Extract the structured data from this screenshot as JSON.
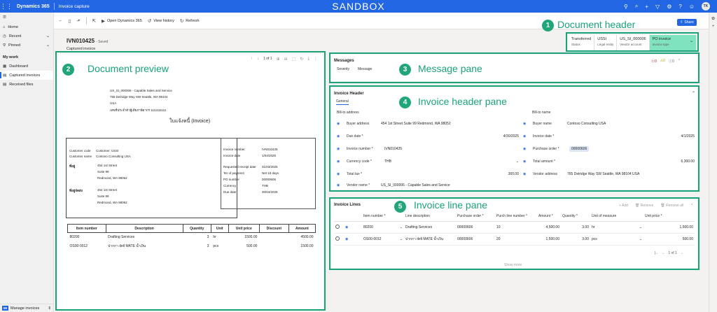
{
  "topbar": {
    "brand": "Dynamics 365",
    "app_name": "Invoice capture",
    "environment": "SANDBOX",
    "user_initials": "TK"
  },
  "nav": {
    "home": "Home",
    "recent": "Recent",
    "pinned": "Pinned",
    "my_work": "My work",
    "dashboard": "Dashboard",
    "captured_invoices": "Captured invoices",
    "received_files": "Received files",
    "bottom_badge": "MI",
    "bottom_label": "Manage invoices"
  },
  "cmdbar": {
    "open_d365": "Open Dynamics 365",
    "view_history": "View history",
    "refresh": "Refresh"
  },
  "share": "Share",
  "document": {
    "id": "IVN010425",
    "saved": "- Saved",
    "subtitle": "Captured invoice"
  },
  "header_fields": [
    {
      "value": "Transferred",
      "label": "Status"
    },
    {
      "value": "USSI",
      "label": "Legal entity"
    },
    {
      "value": "US_SI_000006",
      "label": "Vendor account"
    },
    {
      "value": "PO invoice",
      "label": "Invoice type"
    }
  ],
  "callouts": {
    "c1": {
      "num": "1",
      "label": "Document header"
    },
    "c2": {
      "num": "2",
      "label": "Document preview"
    },
    "c3": {
      "num": "3",
      "label": "Message pane"
    },
    "c4": {
      "num": "4",
      "label": "Invoice header pane"
    },
    "c5": {
      "num": "5",
      "label": "Invoice line pane"
    }
  },
  "preview": {
    "page": "1 of 1",
    "vendor_name": "US_SI_000006 - Capable Sales and Service",
    "vendor_address": "765 Delridge Way SW Seattle, WA 98104",
    "vendor_country": "USA",
    "tax_id": "เลขที่ประจำตัวผู้เสียภาษีอากร 1111111111",
    "title": "ใบแจ้งหนี้ (Invoice)",
    "customer_code_label": "Customer code",
    "customer_code": "Customer: USSI",
    "customer_name_label": "Customer name",
    "customer_name": "Contoso Consulting USA",
    "address_label": "ที่อยู่",
    "address_lines": [
      "454 1st Street",
      "Suite 99",
      "Redmond, WA 98052"
    ],
    "ship_label": "ที่อยู่จัดส่ง",
    "ship_lines": [
      "454 1st Street",
      "Suite 99",
      "Redmond, WA 98052"
    ],
    "invoice_number_label": "Invoice number",
    "invoice_number": "IVN010425",
    "invoice_date_label": "Invoice date",
    "invoice_date": "1/04/2025",
    "receipt_date_label": "Requested receipt date",
    "receipt_date": "31/03/2025",
    "terms_label": "Ter of payment",
    "terms": "Net 15 days",
    "po_label": "PO number",
    "po": "00000606",
    "currency_label": "Currency",
    "currency": "THB",
    "due_label": "Due date",
    "due": "30/04/2025",
    "table_headers": [
      "Item number",
      "Description",
      "Quantity",
      "Unit",
      "Unit price",
      "Discount",
      "Amount"
    ],
    "rows": [
      [
        "80200",
        "Drafting Services",
        "3",
        "hr",
        "1500.00",
        "",
        "4500.00"
      ],
      [
        "OS00-0012",
        "ปากกา dell MATE น้ำเงิน",
        "3",
        "pcs",
        "500.00",
        "",
        "1500.00"
      ]
    ]
  },
  "messages": {
    "title": "Messages",
    "col_severity": "Severity",
    "col_message": "Message",
    "counts": [
      "0",
      "0",
      "0"
    ]
  },
  "invoice_header": {
    "title": "Invoice Header",
    "tab": "General",
    "bill_to_address": "Bill-to address",
    "bill_to_name": "Bill-to name",
    "left_fields": [
      {
        "label": "Buyer address",
        "value": "454 1st Street Suite 99 Redmond, WA 98052"
      },
      {
        "label": "Due date *",
        "value": "4/30/2025"
      },
      {
        "label": "Invoice number *",
        "value": "IVN010425"
      },
      {
        "label": "Currency code *",
        "value": "THB"
      },
      {
        "label": "Total tax *",
        "value": "300.00"
      },
      {
        "label": "Vendor name *",
        "value": "US_SI_000006 - Capable Sales and Service"
      }
    ],
    "right_fields": [
      {
        "label": "Buyer name",
        "value": "Contoso Consulting USA"
      },
      {
        "label": "Invoice date *",
        "value": "4/1/2025"
      },
      {
        "label": "Purchase order *",
        "value": "00000606"
      },
      {
        "label": "Total amount *",
        "value": "6,300.00"
      },
      {
        "label": "Vendor address",
        "value": "765 Delridge Way SW Seattle, WA 98104 USA"
      }
    ]
  },
  "invoice_lines": {
    "title": "Invoice Lines",
    "actions": [
      "Add",
      "Remove",
      "Remove all"
    ],
    "headers": [
      "Item number *",
      "Line description",
      "Purchase order *",
      "Purch line number *",
      "Amount *",
      "Quantity *",
      "Unit of measure",
      "Unit price *"
    ],
    "rows": [
      [
        "80200",
        "Drafting Services",
        "00000606",
        "10",
        "4,500.00",
        "3.00",
        "hr",
        "1,500.00"
      ],
      [
        "OS00-0012",
        "ปากกา dell MATE น้ำเงิน",
        "00000606",
        "20",
        "1,500.00",
        "3.00",
        "pcs",
        "500.00"
      ]
    ],
    "pager": "1 of 1",
    "show_more": "Show more"
  }
}
